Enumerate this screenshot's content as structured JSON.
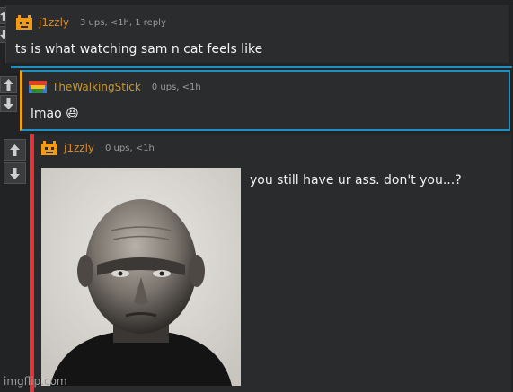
{
  "comments": [
    {
      "username": "j1zzly",
      "meta": "3 ups, <1h, 1 reply",
      "text": "ts is what watching sam n cat feels like"
    },
    {
      "username": "TheWalkingStick",
      "meta": "0 ups, <1h",
      "text": "lmao 😆"
    },
    {
      "username": "j1zzly",
      "meta": "0 ups, <1h",
      "text": "you still have ur ass. don't you...?",
      "image": "bald-man-portrait"
    }
  ],
  "icons": {
    "upvote": "arrow-up-icon",
    "downvote": "arrow-down-icon"
  },
  "colors": {
    "background": "#222324",
    "username": "#d98a2a",
    "reply_accent_blue": "#1f8fc4",
    "reply_accent_orange": "#f0a018",
    "reply_accent_red": "#e23434"
  },
  "watermark": "imgflip.com"
}
